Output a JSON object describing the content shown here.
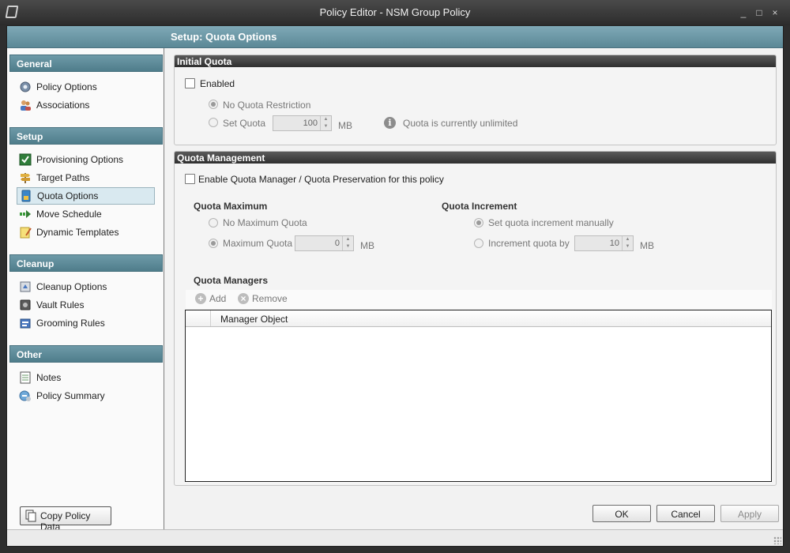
{
  "window": {
    "title": "Policy Editor - NSM Group Policy",
    "controls": [
      "_",
      "□",
      "×"
    ]
  },
  "header": {
    "title": "Setup: Quota Options"
  },
  "sidebar": {
    "categories": [
      {
        "label": "General",
        "items": [
          {
            "label": "Policy Options",
            "icon": "gear-icon"
          },
          {
            "label": "Associations",
            "icon": "users-icon"
          }
        ]
      },
      {
        "label": "Setup",
        "items": [
          {
            "label": "Provisioning Options",
            "icon": "checkbox-icon"
          },
          {
            "label": "Target Paths",
            "icon": "signpost-icon"
          },
          {
            "label": "Quota Options",
            "icon": "quota-icon",
            "active": true
          },
          {
            "label": "Move Schedule",
            "icon": "arrow-icon"
          },
          {
            "label": "Dynamic Templates",
            "icon": "template-icon"
          }
        ]
      },
      {
        "label": "Cleanup",
        "items": [
          {
            "label": "Cleanup Options",
            "icon": "cleanup-icon"
          },
          {
            "label": "Vault Rules",
            "icon": "vault-icon"
          },
          {
            "label": "Grooming Rules",
            "icon": "grooming-icon"
          }
        ]
      },
      {
        "label": "Other",
        "items": [
          {
            "label": "Notes",
            "icon": "notes-icon"
          },
          {
            "label": "Policy Summary",
            "icon": "summary-icon"
          }
        ]
      }
    ],
    "copy_button": "Copy Policy Data"
  },
  "initial_quota": {
    "title": "Initial Quota",
    "enabled_label": "Enabled",
    "no_quota_label": "No Quota Restriction",
    "set_quota_label": "Set Quota",
    "set_quota_value": "100",
    "unit": "MB",
    "info_text": "Quota is currently unlimited"
  },
  "quota_management": {
    "title": "Quota Management",
    "enable_label": "Enable Quota Manager / Quota Preservation for this policy",
    "max_title": "Quota Maximum",
    "no_max_label": "No Maximum Quota",
    "max_quota_label": "Maximum Quota",
    "max_value": "0",
    "unit": "MB",
    "inc_title": "Quota Increment",
    "inc_manual_label": "Set quota increment manually",
    "inc_by_label": "Increment quota by",
    "inc_value": "10",
    "managers_title": "Quota Managers",
    "add_label": "Add",
    "remove_label": "Remove",
    "column_header": "Manager Object"
  },
  "buttons": {
    "ok": "OK",
    "cancel": "Cancel",
    "apply": "Apply"
  }
}
